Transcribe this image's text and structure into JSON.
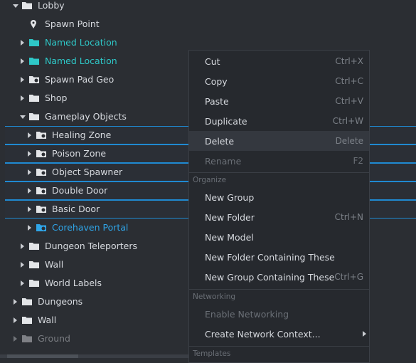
{
  "tree": {
    "items": [
      {
        "label": "Lobby"
      },
      {
        "label": "Spawn Point"
      },
      {
        "label": "Named Location"
      },
      {
        "label": "Named Location"
      },
      {
        "label": "Spawn Pad Geo"
      },
      {
        "label": "Shop"
      },
      {
        "label": "Gameplay Objects"
      },
      {
        "label": "Healing Zone"
      },
      {
        "label": "Poison Zone"
      },
      {
        "label": "Object Spawner"
      },
      {
        "label": "Double Door"
      },
      {
        "label": "Basic Door"
      },
      {
        "label": "Corehaven Portal"
      },
      {
        "label": "Dungeon Teleporters"
      },
      {
        "label": "Wall"
      },
      {
        "label": "World Labels"
      },
      {
        "label": "Dungeons"
      },
      {
        "label": "Wall"
      },
      {
        "label": "Ground"
      }
    ]
  },
  "menu": {
    "items": [
      {
        "label": "Cut",
        "shortcut": "Ctrl+X"
      },
      {
        "label": "Copy",
        "shortcut": "Ctrl+C"
      },
      {
        "label": "Paste",
        "shortcut": "Ctrl+V"
      },
      {
        "label": "Duplicate",
        "shortcut": "Ctrl+W"
      },
      {
        "label": "Delete",
        "shortcut": "Delete"
      },
      {
        "label": "Rename",
        "shortcut": "F2"
      },
      {
        "label": "New Group",
        "shortcut": ""
      },
      {
        "label": "New Folder",
        "shortcut": "Ctrl+N"
      },
      {
        "label": "New Model",
        "shortcut": ""
      },
      {
        "label": "New Folder Containing These",
        "shortcut": ""
      },
      {
        "label": "New Group Containing These",
        "shortcut": "Ctrl+G"
      },
      {
        "label": "Enable Networking",
        "shortcut": ""
      },
      {
        "label": "Create Network Context...",
        "shortcut": ""
      }
    ],
    "sections": {
      "organize": "Organize",
      "networking": "Networking",
      "templates": "Templates"
    }
  },
  "colors": {
    "named_location": "#2ec7c7",
    "portal": "#2fa5e8",
    "selection_border": "#1f8ad2"
  },
  "icons": [
    "folder-icon",
    "pin-icon",
    "expand-arrow-icon",
    "submenu-arrow-icon"
  ]
}
